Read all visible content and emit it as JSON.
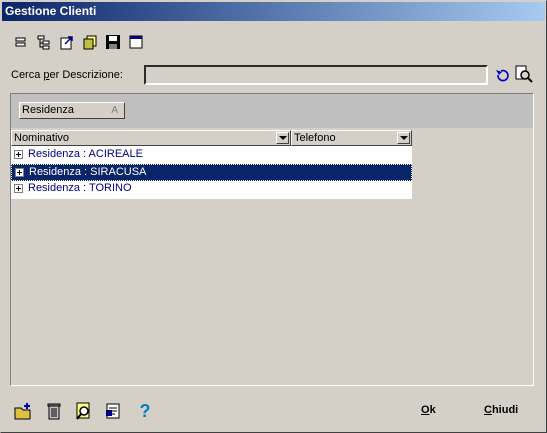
{
  "window": {
    "title": "Gestione Clienti"
  },
  "toolbar": {
    "icons": [
      "collapse-icon",
      "expand-tree-icon",
      "export-icon",
      "copy-icon",
      "save-icon",
      "window-icon"
    ]
  },
  "search": {
    "label_prefix": "Cerca ",
    "label_accel": "p",
    "label_suffix": "er Descrizione:",
    "value": "",
    "placeholder": ""
  },
  "grouping": {
    "chip_label": "Residenza",
    "sort_glyph": "A"
  },
  "grid": {
    "columns": [
      "Nominativo",
      "Telefono"
    ],
    "rows": [
      {
        "label": "Residenza : ACIREALE",
        "selected": false
      },
      {
        "label": "Residenza : SIRACUSA",
        "selected": true
      },
      {
        "label": "Residenza : TORINO",
        "selected": false
      }
    ]
  },
  "footer": {
    "ok_accel": "O",
    "ok_rest": "k",
    "close_accel": "C",
    "close_rest": "hiudi",
    "help_glyph": "?"
  },
  "colors": {
    "titlebar_start": "#0a246a",
    "selection": "#0a246a",
    "group_text": "#000080",
    "face": "#d4d0c8"
  }
}
